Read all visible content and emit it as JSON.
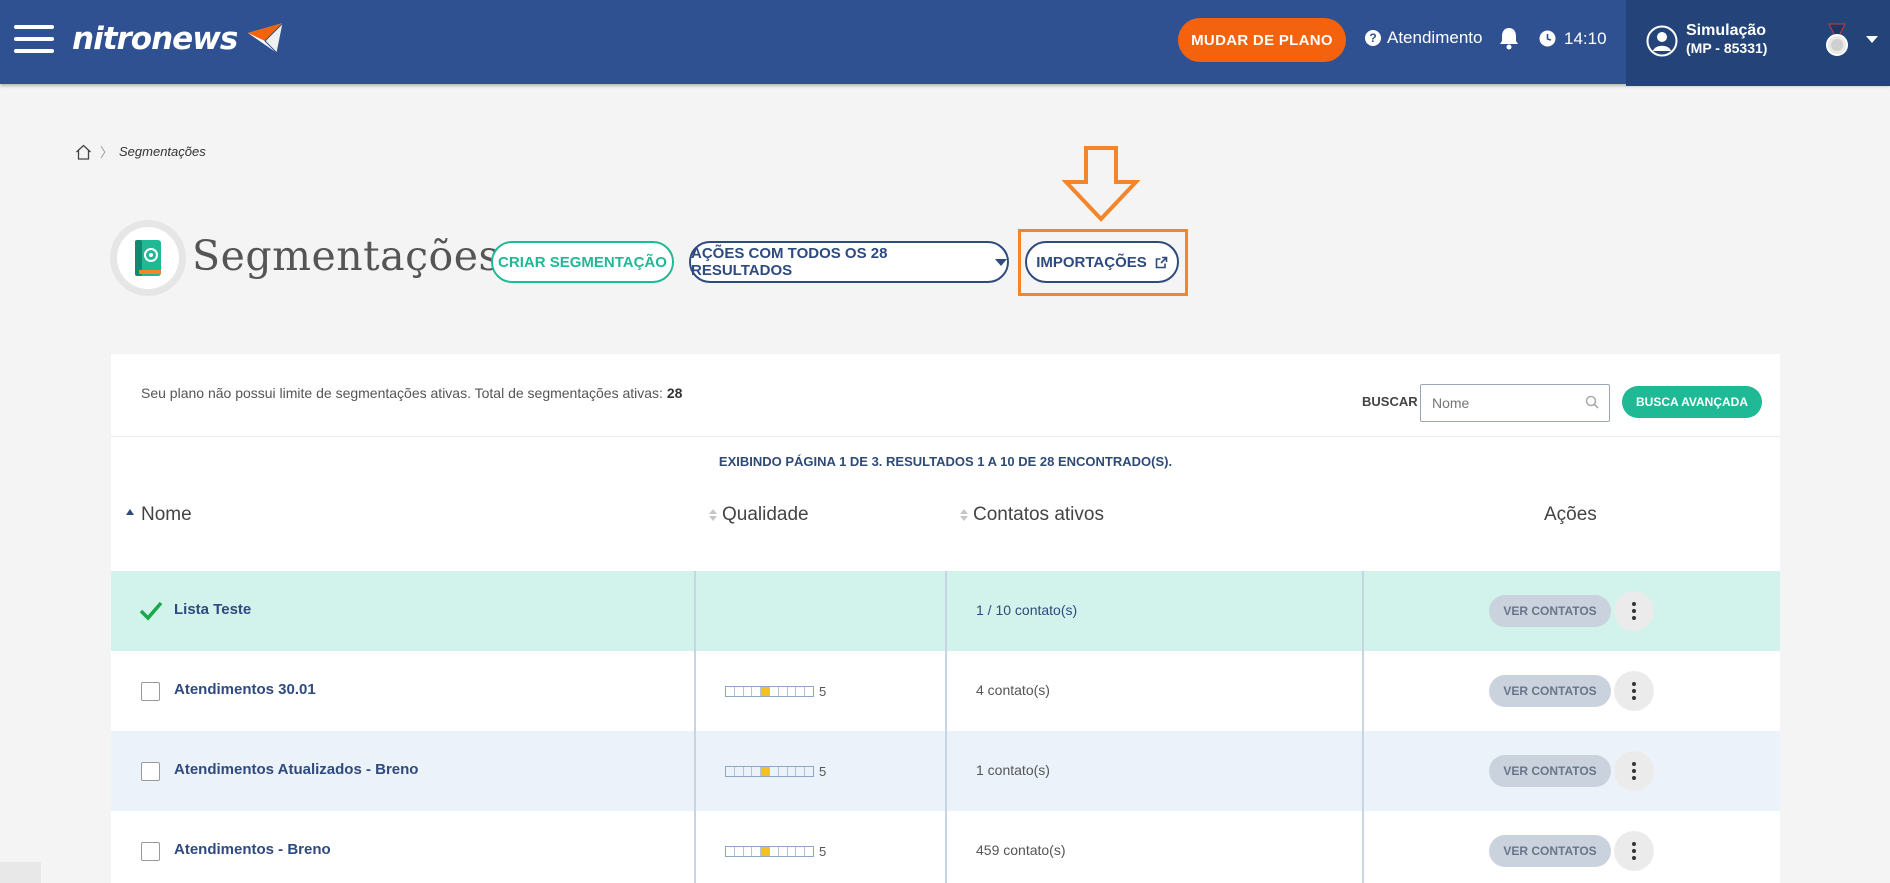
{
  "header": {
    "brand": "nitronews",
    "plan_button": "MUDAR DE PLANO",
    "help_label": "Atendimento",
    "help_icon": "question-circle-icon",
    "time": "14:10",
    "user_name": "Simulação",
    "user_account": "(MP - 85331)",
    "brand_color": "#2f5192",
    "accent_orange": "#f4620d"
  },
  "breadcrumb": {
    "current": "Segmentações"
  },
  "page": {
    "title": "Segmentações",
    "create_button": "CRIAR SEGMENTAÇÃO",
    "actions_button": "AÇÕES COM TODOS OS 28 RESULTADOS",
    "imports_button": "IMPORTAÇÕES"
  },
  "toolbar": {
    "plan_info": "Seu plano não possui limite de segmentações ativas. Total de segmentações ativas:",
    "active_total": "28",
    "search_label": "BUSCAR",
    "search_placeholder": "Nome",
    "advanced_search": "BUSCA AVANÇADA"
  },
  "pagination_info": "EXIBINDO PÁGINA 1 DE 3. RESULTADOS 1 A 10 DE 28 ENCONTRADO(S).",
  "table": {
    "columns": [
      "Nome",
      "Qualidade",
      "Contatos ativos",
      "Ações"
    ],
    "view_label": "VER CONTATOS",
    "rows": [
      {
        "name": "Lista Teste",
        "selected": true,
        "quality": "",
        "contacts": "1 / 10 contato(s)"
      },
      {
        "name": "Atendimentos 30.01",
        "selected": false,
        "quality": "5",
        "contacts": "4 contato(s)"
      },
      {
        "name": "Atendimentos Atualizados - Breno",
        "selected": false,
        "quality": "5",
        "contacts": "1 contato(s)"
      },
      {
        "name": "Atendimentos - Breno",
        "selected": false,
        "quality": "5",
        "contacts": "459 contato(s)"
      }
    ]
  },
  "colors": {
    "teal": "#20b996",
    "navy": "#2f4a7e",
    "highlight": "#f4852b",
    "selected_row": "#d1f3ec"
  }
}
